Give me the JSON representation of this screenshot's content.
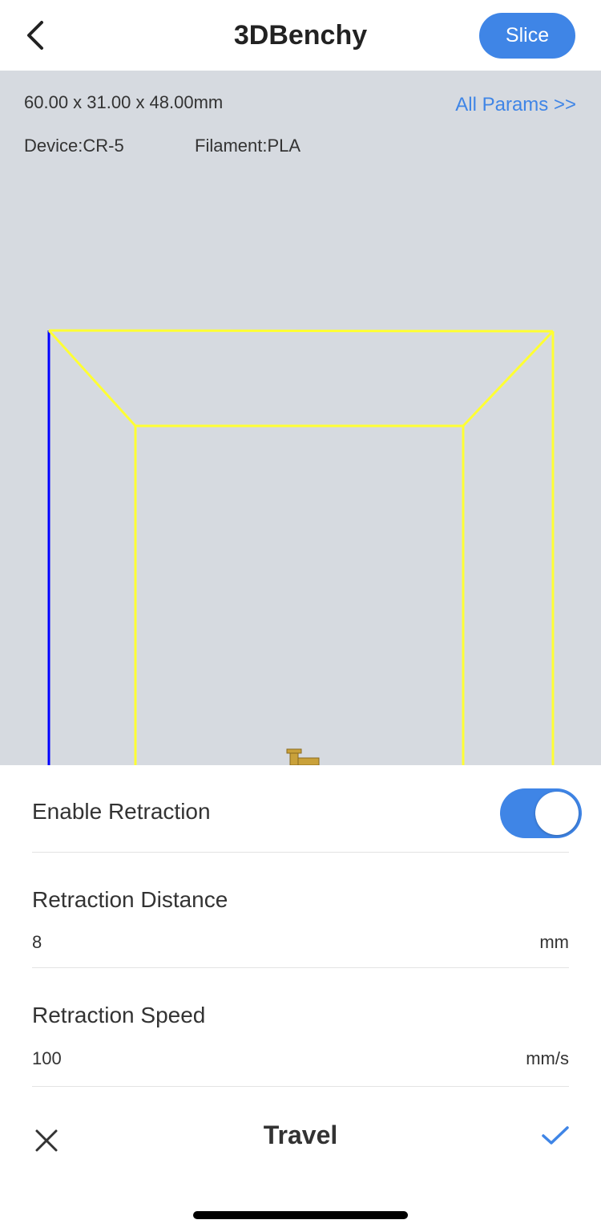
{
  "header": {
    "back_icon": "chevron-left-icon",
    "title": "3DBenchy",
    "slice_label": "Slice"
  },
  "model": {
    "dimensions": "60.00 x 31.00 x 48.00mm",
    "device": "Device:CR-5",
    "filament": "Filament:PLA",
    "all_params_label": "All Params >>"
  },
  "settings": {
    "enable_retraction": {
      "label": "Enable Retraction",
      "enabled": true
    },
    "retraction_distance": {
      "label": "Retraction Distance",
      "value": "8",
      "unit": "mm"
    },
    "retraction_speed": {
      "label": "Retraction Speed",
      "value": "100",
      "unit": "mm/s"
    }
  },
  "footer": {
    "title": "Travel",
    "cancel_icon": "close-icon",
    "confirm_icon": "checkmark-icon"
  },
  "colors": {
    "accent": "#3f85e6",
    "viewport_bg": "#d6dae0",
    "build_volume_outline": "#ffff33",
    "z_axis": "#0000ff",
    "model": "#c9a13a"
  }
}
